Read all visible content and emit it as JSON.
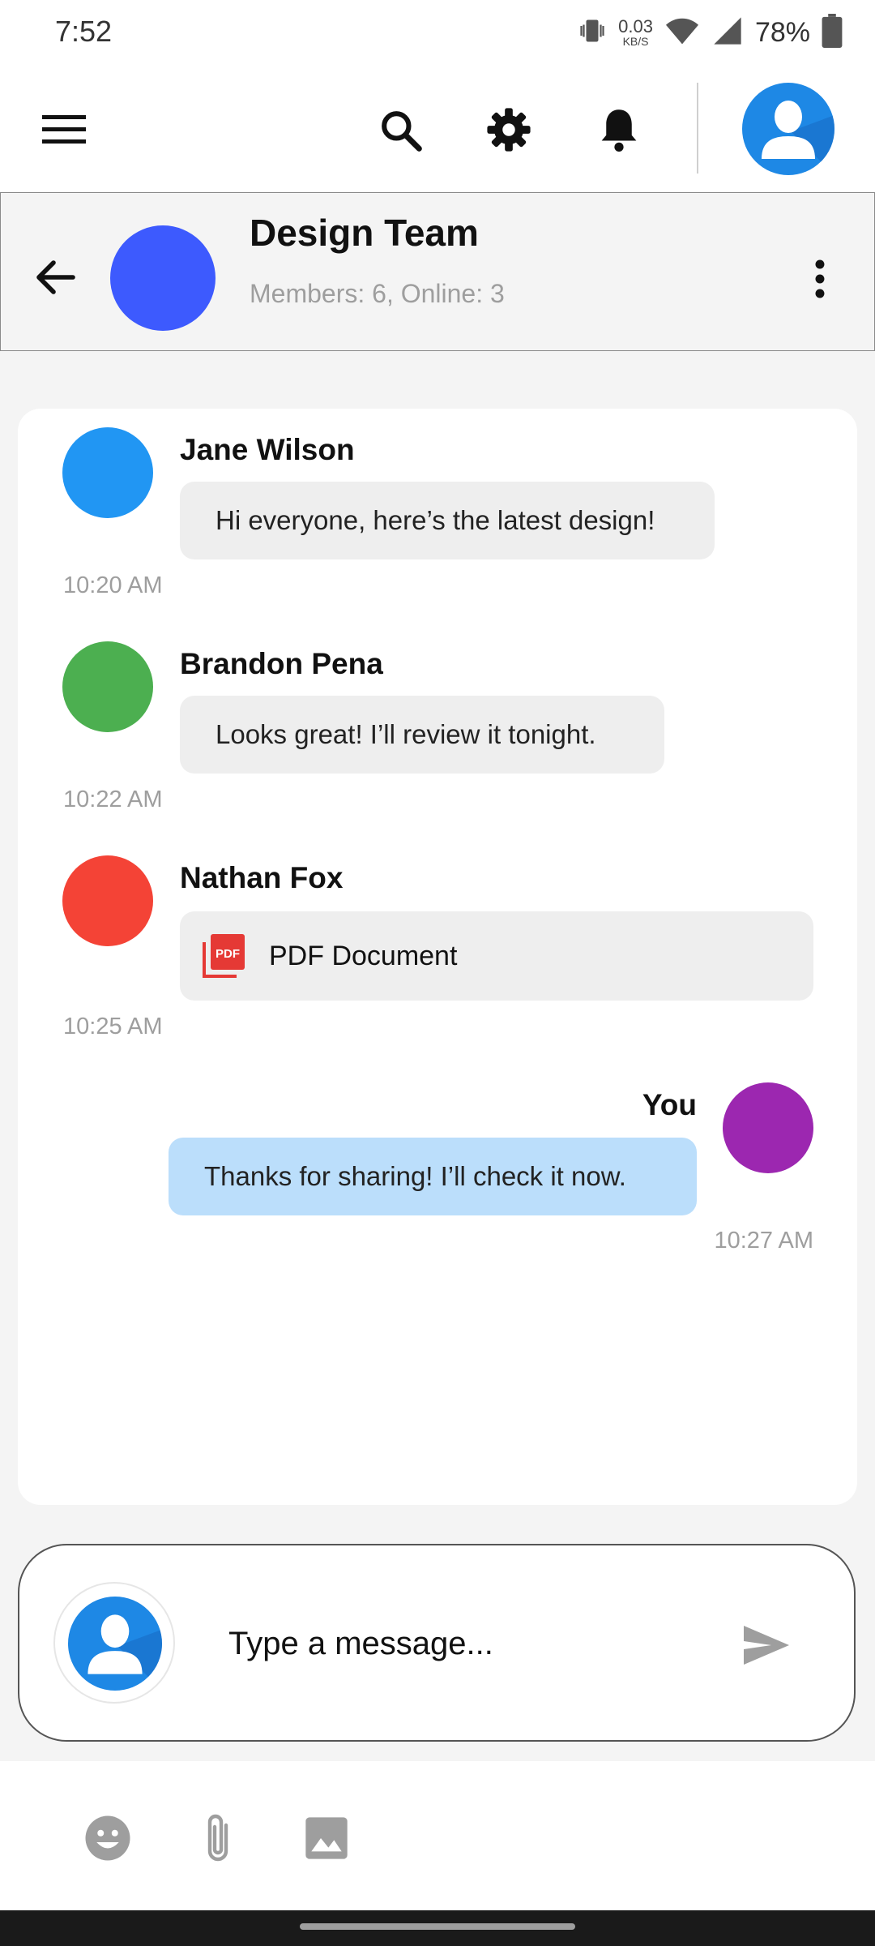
{
  "status_bar": {
    "time": "7:52",
    "net_speed_value": "0.03",
    "net_speed_unit": "KB/S",
    "battery_percent": "78%",
    "icons": [
      "vibrate-icon",
      "wifi-icon",
      "signal-icon",
      "battery-icon"
    ]
  },
  "app_bar": {
    "icons": [
      "menu-icon",
      "search-icon",
      "gear-icon",
      "bell-icon",
      "profile-avatar-icon"
    ]
  },
  "chat_header": {
    "group_name": "Design Team",
    "meta": "Members: 6, Online: 3",
    "avatar_color": "#3d5afe"
  },
  "messages": [
    {
      "sender": "Jane Wilson",
      "text": "Hi everyone, here’s the latest design!",
      "time": "10:20 AM",
      "avatar_color": "#2196f3"
    },
    {
      "sender": "Brandon Pena",
      "text": "Looks great! I’ll review it tonight.",
      "time": "10:22 AM",
      "avatar_color": "#4caf50"
    },
    {
      "sender": "Nathan Fox",
      "attachment": {
        "label": "PDF Document",
        "icon": "pdf-icon",
        "badge": "PDF"
      },
      "time": "10:25 AM",
      "avatar_color": "#f44336"
    },
    {
      "sender": "You",
      "text": "Thanks for sharing! I’ll check it now.",
      "time": "10:27 AM",
      "avatar_color": "#9c27b0",
      "outgoing": true
    }
  ],
  "composer": {
    "placeholder": "Type a message...",
    "icons": [
      "user-avatar-icon",
      "send-icon"
    ]
  },
  "bottom_toolbar": {
    "icons": [
      "emoji-icon",
      "attach-icon",
      "image-icon"
    ]
  },
  "colors": {
    "accent": "#1e88e5",
    "outgoing_bubble": "#bbdefb",
    "incoming_bubble": "#eeeeee"
  }
}
